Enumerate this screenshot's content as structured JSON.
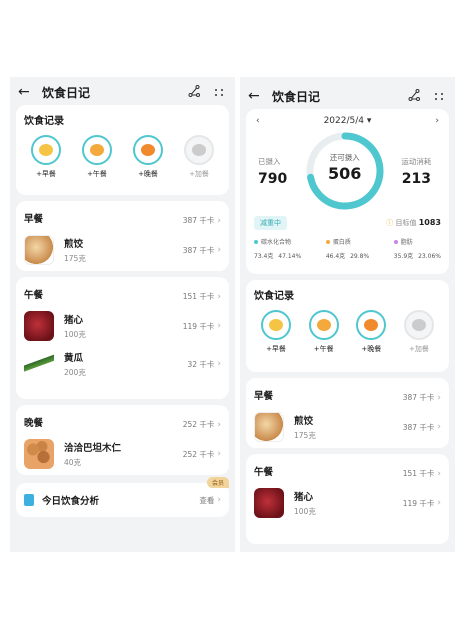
{
  "left": {
    "header": {
      "title": "饮食日记"
    },
    "record": {
      "title": "饮食记录",
      "buttons": [
        {
          "label": "+早餐",
          "color": "#f6c444"
        },
        {
          "label": "+午餐",
          "color": "#f3a93c"
        },
        {
          "label": "+晚餐",
          "color": "#f08a2c"
        },
        {
          "label": "+加餐",
          "color": "#cccccc"
        }
      ]
    },
    "breakfast": {
      "name": "早餐",
      "kcal": "387 千卡",
      "items": [
        {
          "name": "煎饺",
          "qty": "175克",
          "kcal": "387 千卡"
        }
      ]
    },
    "lunch": {
      "name": "午餐",
      "kcal": "151 千卡",
      "items": [
        {
          "name": "猪心",
          "qty": "100克",
          "kcal": "119 千卡"
        },
        {
          "name": "黄瓜",
          "qty": "200克",
          "kcal": "32 千卡"
        }
      ]
    },
    "dinner": {
      "name": "晚餐",
      "kcal": "252 千卡",
      "items": [
        {
          "name": "洽洽巴坦木仁",
          "qty": "40克",
          "kcal": "252 千卡"
        }
      ]
    },
    "analysis": {
      "title": "今日饮食分析",
      "action": "查看",
      "badge": "会员"
    }
  },
  "right": {
    "header": {
      "title": "饮食日记"
    },
    "summary": {
      "date": "2022/5/4",
      "intake_label": "已摄入",
      "intake": "790",
      "remaining_label": "还可摄入",
      "remaining": "506",
      "burn_label": "运动消耗",
      "burn": "213",
      "status": "减重中",
      "target_label": "目标值",
      "target": "1083",
      "remaining_fraction": 0.72,
      "macros": [
        {
          "name": "碳水化合物",
          "grams": "73.4克",
          "pct": "47.14%",
          "color": "#4fc7cf"
        },
        {
          "name": "蛋白质",
          "grams": "46.4克",
          "pct": "29.8%",
          "color": "#f3a93c"
        },
        {
          "name": "脂肪",
          "grams": "35.9克",
          "pct": "23.06%",
          "color": "#c785e8"
        }
      ]
    },
    "record": {
      "title": "饮食记录",
      "buttons": [
        {
          "label": "+早餐"
        },
        {
          "label": "+午餐"
        },
        {
          "label": "+晚餐"
        },
        {
          "label": "+加餐"
        }
      ]
    },
    "breakfast": {
      "name": "早餐",
      "kcal": "387 千卡",
      "item": {
        "name": "煎饺",
        "qty": "175克",
        "kcal": "387 千卡"
      }
    },
    "lunch": {
      "name": "午餐",
      "kcal": "151 千卡",
      "item": {
        "name": "猪心",
        "qty": "100克",
        "kcal": "119 千卡"
      }
    },
    "accent": "#4fc7cf"
  }
}
